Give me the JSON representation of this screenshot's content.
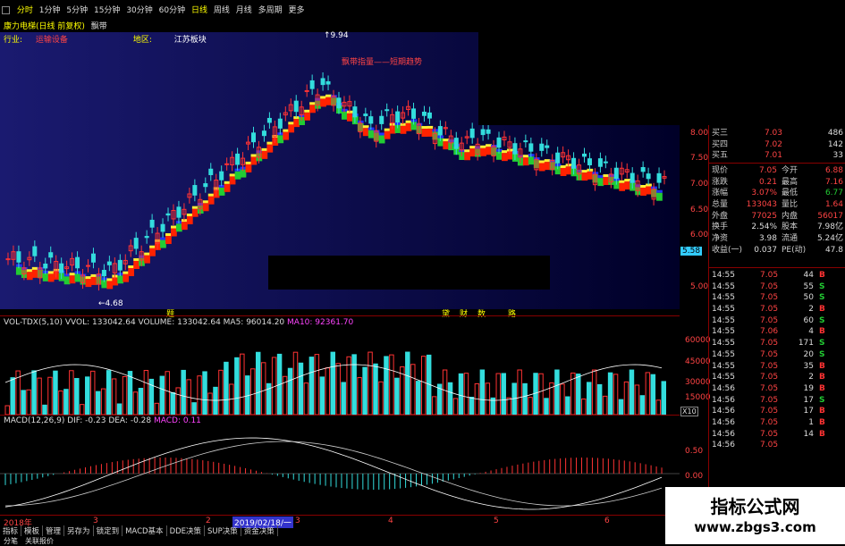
{
  "toolbar": {
    "items": [
      "分时",
      "1分钟",
      "5分钟",
      "15分钟",
      "30分钟",
      "60分钟",
      "日线",
      "周线",
      "月线",
      "多周期",
      "更多"
    ]
  },
  "stock_title": "康力电梯(日线 前复权)",
  "stock_title_suffix": "飘带",
  "industry_label": "行业:",
  "industry_value": "运输设备",
  "region_label": "地区:",
  "region_value": "江苏板块",
  "legend_annotation": "飘带指量——短期趋势",
  "price_high": "9.94",
  "price_low": "4.68",
  "price_axis": [
    "8.00",
    "7.50",
    "7.00",
    "6.50",
    "6.00",
    "5.58",
    "5.00"
  ],
  "event_marks": [
    "题",
    "黛",
    "财",
    "数",
    "路"
  ],
  "vol_header": "VOL-TDX(5,10)  VVOL: 133042.64  VOLUME: 133042.64  MA5: 96014.20",
  "vol_ma10": "MA10: 92361.70",
  "vol_axis": [
    "60000",
    "45000",
    "30000",
    "15000",
    "X10"
  ],
  "macd_header": "MACD(12,26,9)  DIF: -0.23  DEA: -0.28",
  "macd_val": "MACD: 0.11",
  "macd_axis": [
    "0.50",
    "0.00"
  ],
  "date_axis": [
    "2018年",
    "3",
    "2",
    "2019/02/18/一",
    "3",
    "4",
    "5",
    "6"
  ],
  "bottom_tabs": [
    "指标",
    "模板",
    "管理",
    "另存为",
    "锁定到",
    "MACD基本",
    "DDE决策",
    "SUP决策",
    "资金决策"
  ],
  "bottom_tabs2": [
    "分笔",
    "关联报价"
  ],
  "quote": {
    "asks": [
      {
        "label": "买三",
        "price": "7.03",
        "vol": "486"
      },
      {
        "label": "买四",
        "price": "7.02",
        "vol": "142"
      },
      {
        "label": "买五",
        "price": "7.01",
        "vol": "33"
      }
    ],
    "stats": [
      {
        "l1": "现价",
        "v1": "7.05",
        "l2": "今开",
        "v2": "6.88"
      },
      {
        "l1": "涨跌",
        "v1": "0.21",
        "l2": "最高",
        "v2": "7.16"
      },
      {
        "l1": "涨幅",
        "v1": "3.07%",
        "l2": "最低",
        "v2": "6.77"
      },
      {
        "l1": "总量",
        "v1": "133043",
        "l2": "量比",
        "v2": "1.64"
      },
      {
        "l1": "外盘",
        "v1": "77025",
        "l2": "内盘",
        "v2": "56017"
      },
      {
        "l1": "换手",
        "v1": "2.54%",
        "l2": "股本",
        "v2": "7.98亿"
      },
      {
        "l1": "净资",
        "v1": "3.98",
        "l2": "流通",
        "v2": "5.24亿"
      },
      {
        "l1": "收益(一)",
        "v1": "0.037",
        "l2": "PE(动)",
        "v2": "47.8"
      }
    ],
    "ticks": [
      {
        "t": "14:55",
        "p": "7.05",
        "q": "44",
        "s": "B"
      },
      {
        "t": "14:55",
        "p": "7.05",
        "q": "55",
        "s": "S"
      },
      {
        "t": "14:55",
        "p": "7.05",
        "q": "50",
        "s": "S"
      },
      {
        "t": "14:55",
        "p": "7.05",
        "q": "2",
        "s": "B"
      },
      {
        "t": "14:55",
        "p": "7.05",
        "q": "60",
        "s": "S"
      },
      {
        "t": "14:55",
        "p": "7.06",
        "q": "4",
        "s": "B"
      },
      {
        "t": "14:55",
        "p": "7.05",
        "q": "171",
        "s": "S"
      },
      {
        "t": "14:55",
        "p": "7.05",
        "q": "20",
        "s": "S"
      },
      {
        "t": "14:55",
        "p": "7.05",
        "q": "35",
        "s": "B"
      },
      {
        "t": "14:55",
        "p": "7.05",
        "q": "2",
        "s": "B"
      },
      {
        "t": "14:56",
        "p": "7.05",
        "q": "19",
        "s": "B"
      },
      {
        "t": "14:56",
        "p": "7.05",
        "q": "17",
        "s": "S"
      },
      {
        "t": "14:56",
        "p": "7.05",
        "q": "17",
        "s": "B"
      },
      {
        "t": "14:56",
        "p": "7.05",
        "q": "1",
        "s": "B"
      },
      {
        "t": "14:56",
        "p": "7.05",
        "q": "14",
        "s": "B"
      },
      {
        "t": "14:56",
        "p": "7.05",
        "q": "",
        "s": ""
      }
    ]
  },
  "watermark": {
    "title": "指标公式网",
    "url": "www.zbgs3.com"
  },
  "colors": {
    "up": "#ff3333",
    "down": "#33dddd",
    "ribbon_red": "#ff2200",
    "ribbon_yellow": "#ffee33",
    "ribbon_green": "#22cc33",
    "ribbon_blue": "#2233ff",
    "buy": "#ff3333",
    "sell": "#22cc33"
  }
}
